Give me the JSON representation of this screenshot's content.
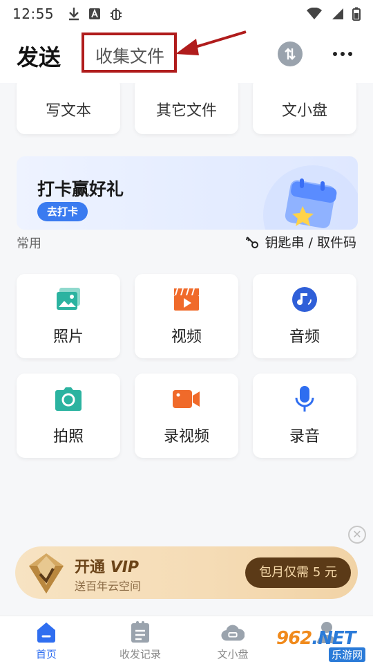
{
  "status_bar": {
    "time": "12:55"
  },
  "header": {
    "tab_send": "发送",
    "tab_collect": "收集文件"
  },
  "top_cards": [
    {
      "label": "写文本"
    },
    {
      "label": "其它文件"
    },
    {
      "label": "文小盘"
    }
  ],
  "banner": {
    "title": "打卡赢好礼",
    "button": "去打卡"
  },
  "common": {
    "section_label": "常用",
    "key_link": "钥匙串 / 取件码",
    "items": [
      {
        "label": "照片",
        "icon": "photo-icon",
        "color": "#2bb3a0"
      },
      {
        "label": "视频",
        "icon": "video-icon",
        "color": "#f06a2a"
      },
      {
        "label": "音频",
        "icon": "music-icon",
        "color": "#2f5fd8"
      },
      {
        "label": "拍照",
        "icon": "camera-icon",
        "color": "#2bb3a0"
      },
      {
        "label": "录视频",
        "icon": "record-video-icon",
        "color": "#f06a2a"
      },
      {
        "label": "录音",
        "icon": "mic-icon",
        "color": "#2f6ef0"
      }
    ]
  },
  "vip": {
    "title_prefix": "开通",
    "title_vip": "VIP",
    "subtitle": "送百年云空间",
    "price_button": "包月仅需 5 元"
  },
  "bottom_nav": [
    {
      "label": "首页",
      "active": true
    },
    {
      "label": "收发记录",
      "active": false
    },
    {
      "label": "文小盘",
      "active": false
    },
    {
      "label": "",
      "active": false
    }
  ],
  "watermark": {
    "main_num": "962",
    "main_tld": ".NET",
    "sub": "乐游网"
  },
  "colors": {
    "accent": "#2f6ef0",
    "highlight": "#b01c1c",
    "vip_dark": "#5b3a17"
  }
}
